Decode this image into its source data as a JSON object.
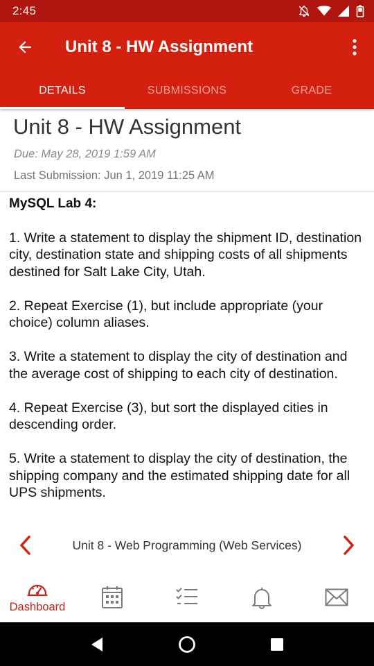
{
  "status_bar": {
    "time": "2:45",
    "icons": [
      "notifications-off-icon",
      "wifi-icon",
      "signal-icon",
      "battery-icon"
    ]
  },
  "app_bar": {
    "title": "Unit 8 - HW Assignment",
    "back_icon": "arrow-back-icon",
    "menu_icon": "more-vert-icon"
  },
  "tabs": [
    {
      "label": "DETAILS",
      "active": true
    },
    {
      "label": "SUBMISSIONS",
      "active": false
    },
    {
      "label": "GRADE",
      "active": false
    }
  ],
  "assignment": {
    "title": "Unit 8 - HW Assignment",
    "due": "Due: May 28, 2019 1:59 AM",
    "last_submission": "Last Submission: Jun 1, 2019 11:25 AM"
  },
  "content": {
    "heading": "MySQL Lab 4:",
    "items": [
      "1. Write a statement to display the shipment ID, destination city, destination state and shipping costs of all shipments destined for Salt Lake City, Utah.",
      "2. Repeat Exercise (1), but include appropriate (your choice) column aliases.",
      "3. Write a statement to display the city of destination and the average cost of shipping to each city of destination.",
      "4. Repeat Exercise (3), but sort the displayed cities in descending order.",
      "5. Write a statement to display the city of destination, the shipping company and the estimated shipping date for all UPS shipments."
    ]
  },
  "course_nav": {
    "course_name": "Unit 8 - Web Programming (Web Services)"
  },
  "bottom_nav": {
    "items": [
      {
        "icon": "dashboard-icon",
        "label": "Dashboard",
        "active": true
      },
      {
        "icon": "calendar-icon",
        "label": "",
        "active": false
      },
      {
        "icon": "todo-list-icon",
        "label": "",
        "active": false
      },
      {
        "icon": "bell-icon",
        "label": "",
        "active": false
      },
      {
        "icon": "mail-icon",
        "label": "",
        "active": false
      }
    ]
  },
  "colors": {
    "status_bar": "#b0160f",
    "primary": "#d3200f",
    "accent": "#c5221a",
    "tab_inactive": "#f4a29a"
  }
}
